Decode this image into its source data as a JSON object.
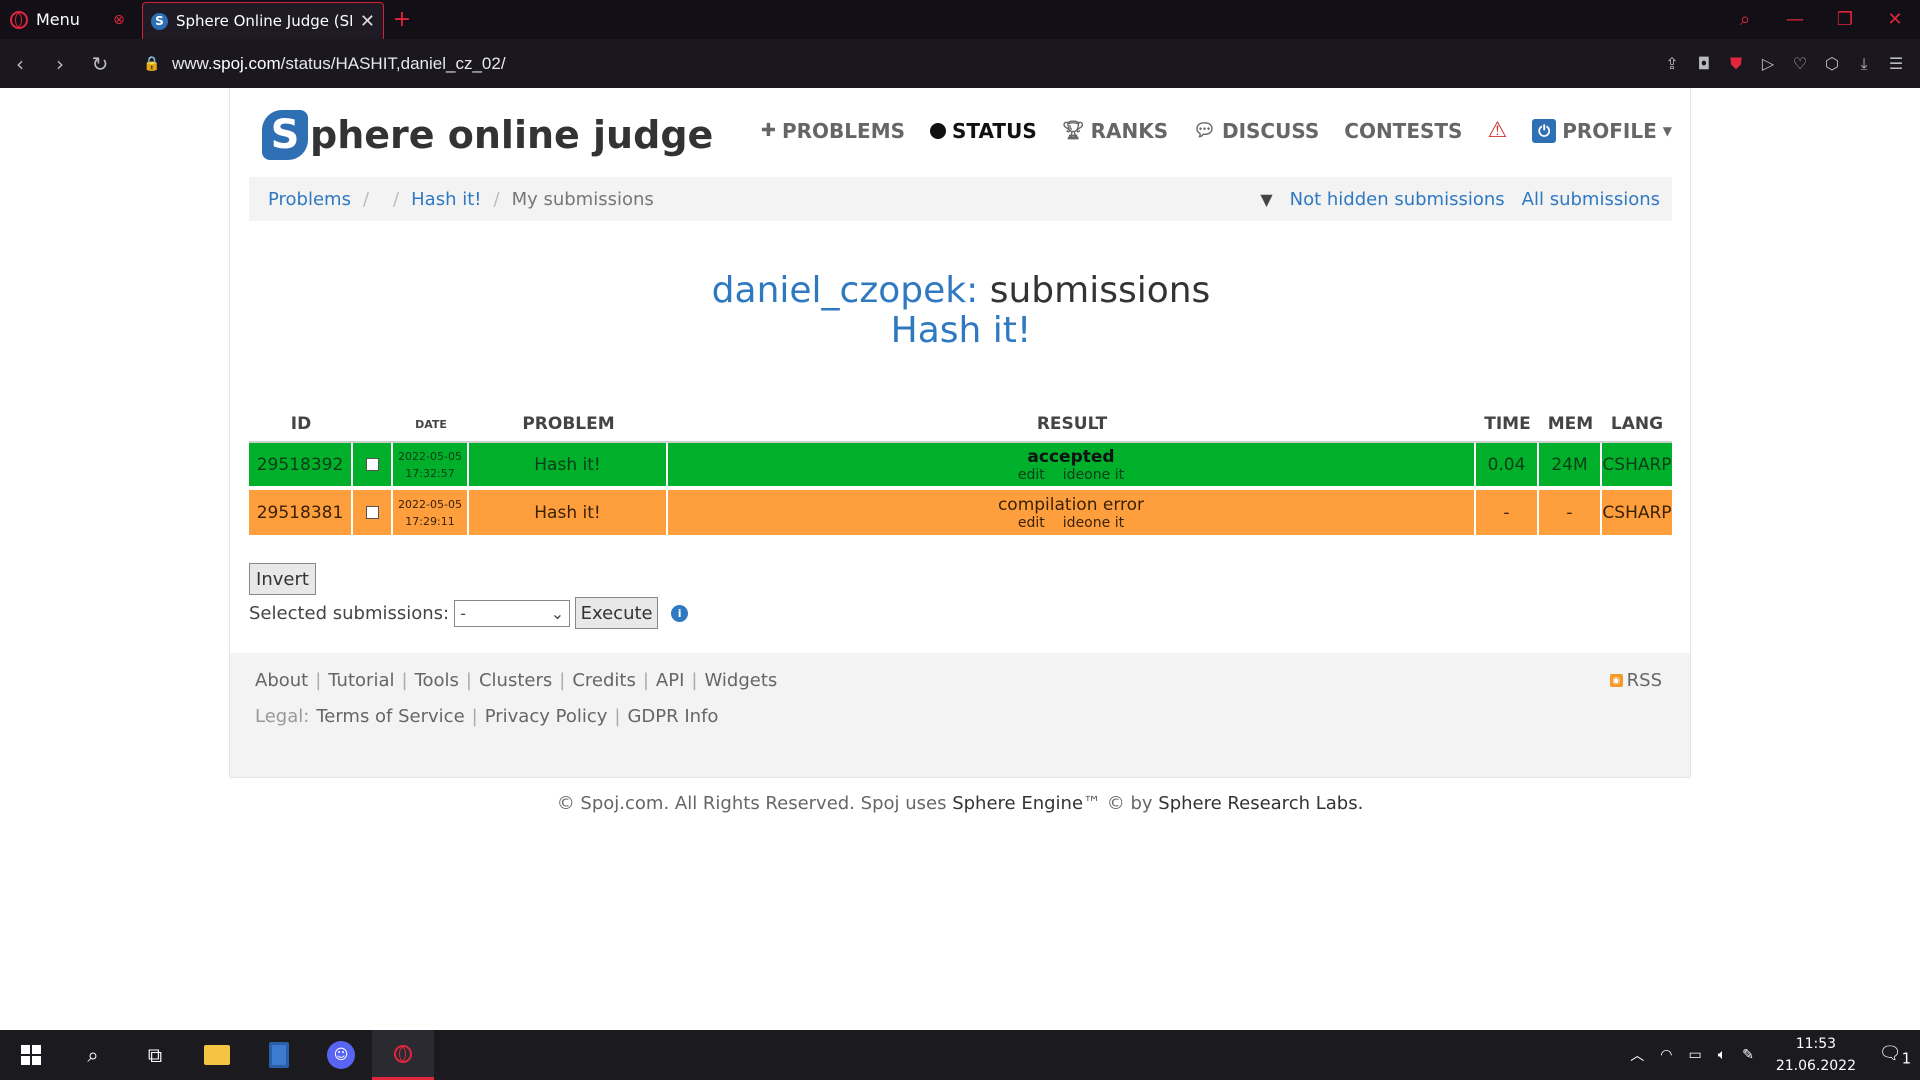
{
  "browser": {
    "menu_label": "Menu",
    "tab_title": "Sphere Online Judge (SPOJ)",
    "url_prefix": "www.",
    "url_host": "spoj.com",
    "url_path": "/status/HASHIT,daniel_cz_02/"
  },
  "site": {
    "logo_letter": "S",
    "logo_text": "phere online judge",
    "nav": {
      "problems": "PROBLEMS",
      "status": "STATUS",
      "ranks": "RANKS",
      "discuss": "DISCUSS",
      "contests": "CONTESTS",
      "profile": "PROFILE"
    }
  },
  "breadcrumb": {
    "problems": "Problems",
    "problem": "Hash it!",
    "current": "My submissions",
    "filter_not_hidden": "Not hidden submissions",
    "filter_all": "All submissions"
  },
  "heading": {
    "user": "daniel_czopek:",
    "suffix": "submissions",
    "problem": "Hash it!"
  },
  "table": {
    "headers": {
      "id": "ID",
      "date": "DATE",
      "problem": "PROBLEM",
      "result": "RESULT",
      "time": "TIME",
      "mem": "MEM",
      "lang": "LANG"
    },
    "rows": [
      {
        "id": "29518392",
        "date": "2022-05-05",
        "time_of_day": "17:32:57",
        "problem": "Hash it!",
        "result": "accepted",
        "link_edit": "edit",
        "link_ideone": "ideone it",
        "time": "0.04",
        "mem": "24M",
        "lang": "CSHARP",
        "status_color": "#00b02b"
      },
      {
        "id": "29518381",
        "date": "2022-05-05",
        "time_of_day": "17:29:11",
        "problem": "Hash it!",
        "result": "compilation error",
        "link_edit": "edit",
        "link_ideone": "ideone it",
        "time": "-",
        "mem": "-",
        "lang": "CSHARP",
        "status_color": "#ff9e3d"
      }
    ]
  },
  "actions": {
    "invert": "Invert",
    "selected_label": "Selected submissions:",
    "select_value": "-",
    "execute": "Execute"
  },
  "footer": {
    "links": [
      "About",
      "Tutorial",
      "Tools",
      "Clusters",
      "Credits",
      "API",
      "Widgets"
    ],
    "legal_label": "Legal:",
    "legal_links": [
      "Terms of Service",
      "Privacy Policy",
      "GDPR Info"
    ],
    "rss": "RSS",
    "copyright_prefix": "© Spoj.com. All Rights Reserved. Spoj uses",
    "engine": "Sphere Engine",
    "tm_by": "™ © by",
    "labs": "Sphere Research Labs."
  },
  "taskbar": {
    "time": "11:53",
    "date": "21.06.2022",
    "notifications": "1"
  },
  "colors": {
    "accent_blue": "#2f79c2",
    "accepted": "#00b02b",
    "compile_error": "#ff9e3d",
    "opera_red": "#e0253c"
  }
}
